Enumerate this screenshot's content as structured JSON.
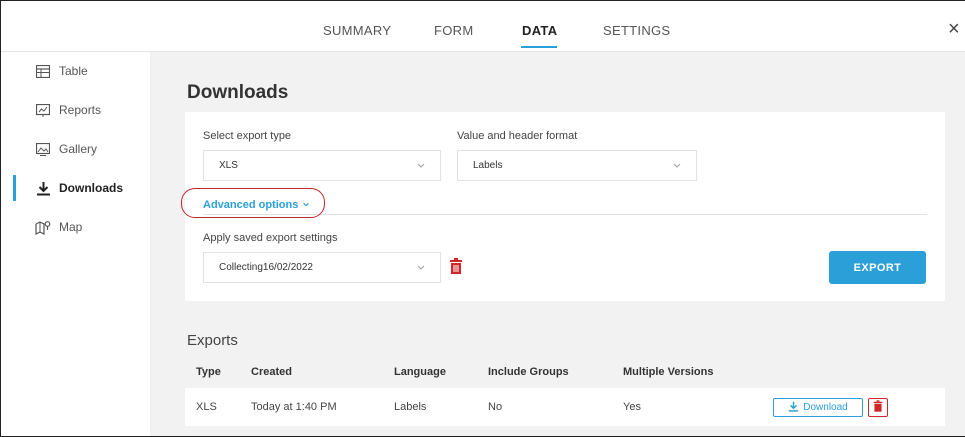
{
  "tabs": [
    {
      "label": "SUMMARY",
      "active": false
    },
    {
      "label": "FORM",
      "active": false
    },
    {
      "label": "DATA",
      "active": true
    },
    {
      "label": "SETTINGS",
      "active": false
    }
  ],
  "close_label": "×",
  "sidebar": {
    "items": [
      {
        "label": "Table",
        "icon": "table-icon",
        "active": false
      },
      {
        "label": "Reports",
        "icon": "reports-icon",
        "active": false
      },
      {
        "label": "Gallery",
        "icon": "gallery-icon",
        "active": false
      },
      {
        "label": "Downloads",
        "icon": "download-icon",
        "active": true
      },
      {
        "label": "Map",
        "icon": "map-icon",
        "active": false
      }
    ]
  },
  "main": {
    "title": "Downloads",
    "export_type": {
      "label": "Select export type",
      "value": "XLS"
    },
    "header_format": {
      "label": "Value and header format",
      "value": "Labels"
    },
    "advanced_options_label": "Advanced options",
    "saved_settings": {
      "label": "Apply saved export settings",
      "value": "Collecting16/02/2022"
    },
    "export_button": "EXPORT",
    "exports_title": "Exports",
    "columns": [
      "Type",
      "Created",
      "Language",
      "Include Groups",
      "Multiple Versions"
    ],
    "rows": [
      {
        "type": "XLS",
        "created": "Today at 1:40 PM",
        "language": "Labels",
        "include_groups": "No",
        "multiple_versions": "Yes"
      }
    ],
    "download_button": "Download"
  },
  "colors": {
    "accent": "#2a9fd8",
    "danger": "#d0262c",
    "background": "#f2f2f2"
  }
}
